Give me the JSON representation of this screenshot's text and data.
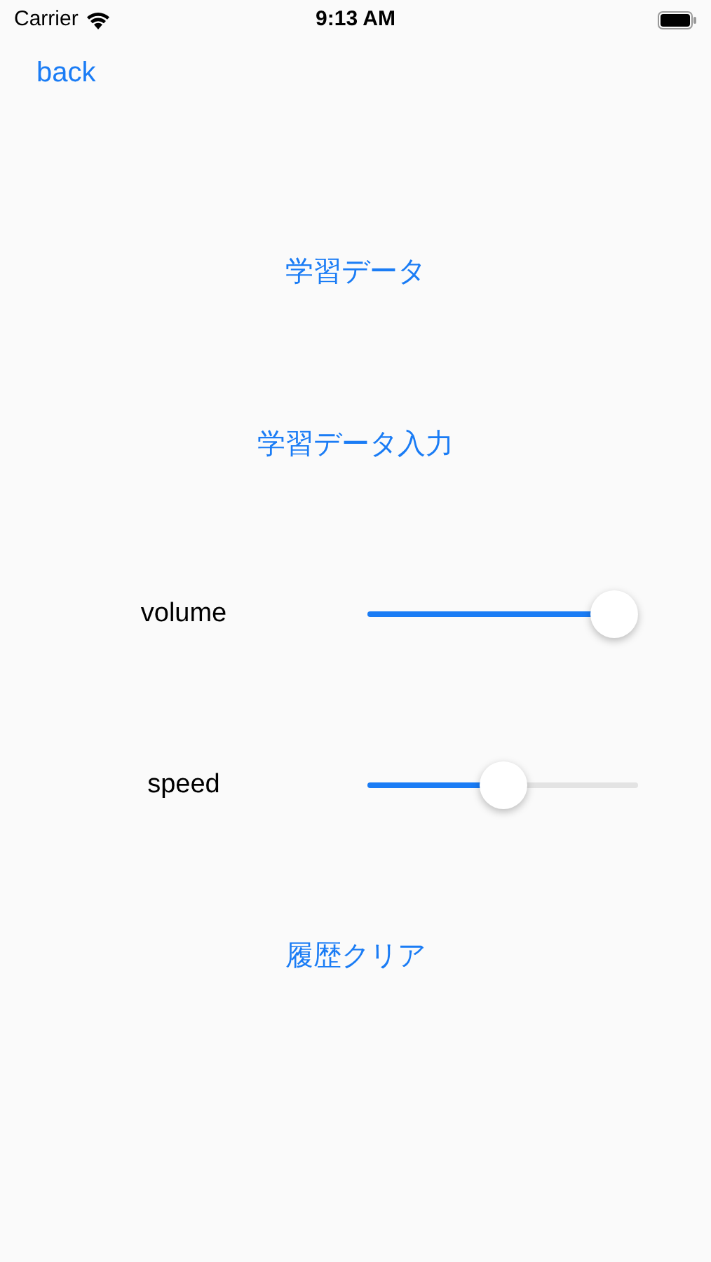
{
  "status_bar": {
    "carrier": "Carrier",
    "time": "9:13 AM"
  },
  "nav": {
    "back": "back"
  },
  "buttons_top": [
    "学習データ",
    "学習データ入力"
  ],
  "sliders": [
    {
      "label": "volume",
      "level": 0.91
    },
    {
      "label": "speed",
      "level": 0.5
    }
  ],
  "buttons_bottom": [
    "履歴クリア"
  ]
}
